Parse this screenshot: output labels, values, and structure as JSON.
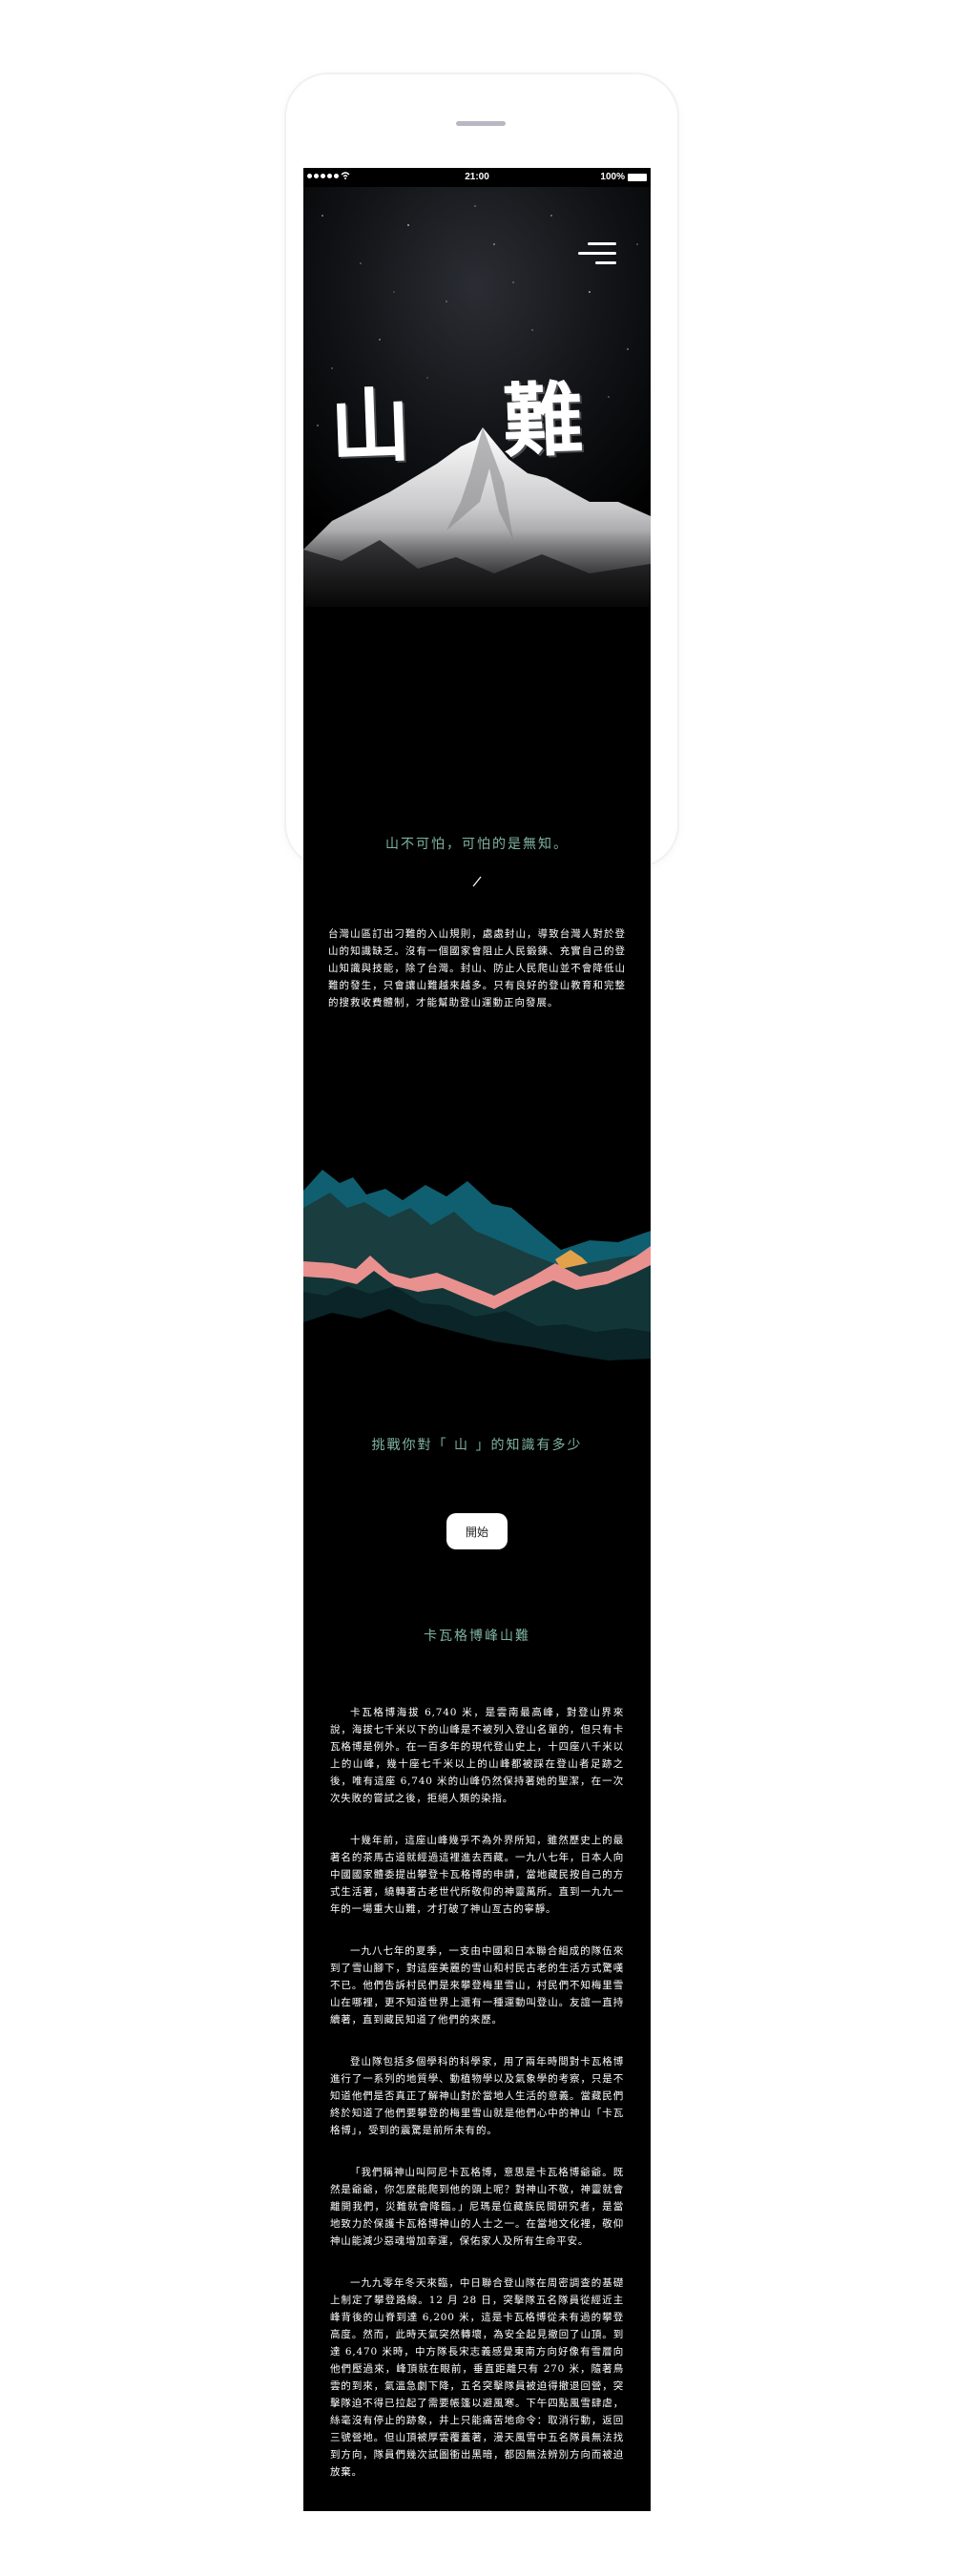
{
  "status_bar": {
    "time": "21:00",
    "battery": "100%"
  },
  "hero": {
    "title": "山 難"
  },
  "tagline": "山不可怕，可怕的是無知。",
  "intro": "台灣山區訂出刁難的入山規則，處處封山，導致台灣人對於登山的知識缺乏。沒有一個國家會阻止人民鍛鍊、充實自己的登山知識與技能，除了台灣。封山、防止人民爬山並不會降低山難的發生，只會讓山難越來越多。只有良好的登山教育和完整的搜救收費體制，才能幫助登山運動正向發展。",
  "challenge": "挑戰你對「 山 」的知識有多少",
  "start_button": "開始",
  "section_title": "卡瓦格博峰山難",
  "article": [
    "卡瓦格博海拔 6,740 米，是雲南最高峰，對登山界來說，海拔七千米以下的山峰是不被列入登山名單的，但只有卡瓦格博是例外。在一百多年的現代登山史上，十四座八千米以上的山峰，幾十座七千米以上的山峰都被踩在登山者足跡之後，唯有這座 6,740 米的山峰仍然保持著她的聖潔，在一次次失敗的嘗試之後，拒絕人類的染指。",
    "十幾年前，這座山峰幾乎不為外界所知，雖然歷史上的最著名的茶馬古道就經過這裡進去西藏。一九八七年，日本人向中國國家體委提出攀登卡瓦格博的申請，當地藏民按自己的方式生活著，繞轉著古老世代所敬仰的神靈萬所。直到一九九一年的一場重大山難，才打破了神山亙古的寧靜。",
    "一九八七年的夏季，一支由中國和日本聯合組成的隊伍來到了雪山腳下，對這座美麗的雪山和村民古老的生活方式驚嘆不已。他們告訴村民們是來攀登梅里雪山，村民們不知梅里雪山在哪裡，更不知道世界上還有一種運動叫登山。友誼一直持續著，直到藏民知道了他們的來歷。",
    "登山隊包括多個學科的科學家，用了兩年時間對卡瓦格博進行了一系列的地質學、動植物學以及氣象學的考察，只是不知道他們是否真正了解神山對於當地人生活的意義。當藏民們終於知道了他們要攀登的梅里雪山就是他們心中的神山「卡瓦格博」，受到的震驚是前所未有的。",
    "「我們稱神山叫阿尼卡瓦格博，意思是卡瓦格博爺爺。既然是爺爺，你怎麼能爬到他的頭上呢？對神山不敬，神靈就會離開我們，災難就會降臨。」尼瑪是位藏族民間研究者，是當地致力於保護卡瓦格博神山的人士之一。在當地文化裡，敬仰神山能減少惡魂增加幸運，保佑家人及所有生命平安。",
    "一九九零年冬天來臨，中日聯合登山隊在周密調查的基礎上制定了攀登路線。12 月 28 日，突擊隊五名隊員從經近主峰背後的山脊到達 6,200 米，這是卡瓦格博從未有過的攀登高度。然而，此時天氣突然轉壞，為安全起見撤回了山頂。到達 6,470 米時，中方隊長宋志義感覺東南方向好像有雪層向他們壓過來，峰頂就在眼前，垂直距離只有 270 米，隨著鳥雲的到來，氣溫急劇下降，五名突擊隊員被迫得撤退回營，突擊隊迫不得已拉起了需要帳篷以避風寒。下午四點風雪肆虐，絲毫沒有停止的跡象，井上只能痛苦地命令：取消行動，返回三號營地。但山頂被厚雲覆蓋著，漫天風雪中五名隊員無法找到方向，隊員們幾次試圖衝出黑暗，都因無法辨別方向而被迫放棄。"
  ]
}
